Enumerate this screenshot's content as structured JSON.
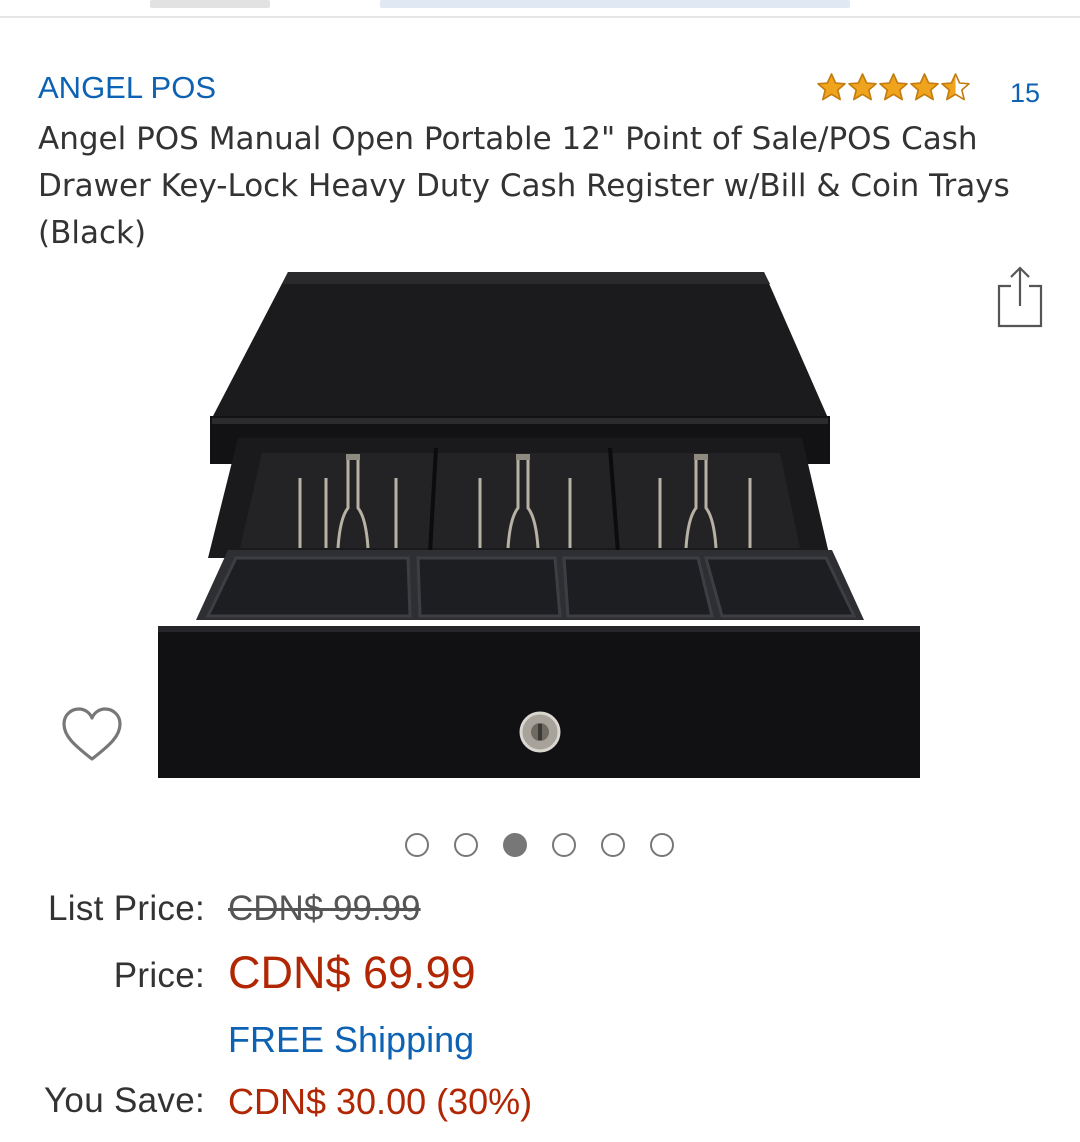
{
  "product": {
    "brand": "ANGEL POS",
    "title": "Angel POS Manual Open Portable 12\" Point of Sale/POS Cash Drawer Key-Lock Heavy Duty Cash Register w/Bill & Coin Trays (Black)",
    "rating": 4.5,
    "rating_max": 5,
    "review_count": "15",
    "image_alt": "Black cash drawer with open bill and coin trays and key lock"
  },
  "gallery": {
    "total_images": 6,
    "active_index": 2
  },
  "pricing": {
    "list_price_label": "List Price:",
    "list_price_value": "CDN$ 99.99",
    "price_label": "Price:",
    "price_value": "CDN$ 69.99",
    "shipping": "FREE Shipping",
    "you_save_label": "You Save:",
    "you_save_value": "CDN$ 30.00 (30%)"
  },
  "icons": {
    "star_color": "#f0a31c",
    "share": "share-icon",
    "wishlist": "heart-icon"
  },
  "colors": {
    "link": "#0e62b3",
    "price": "#b12704",
    "text": "#333333"
  }
}
